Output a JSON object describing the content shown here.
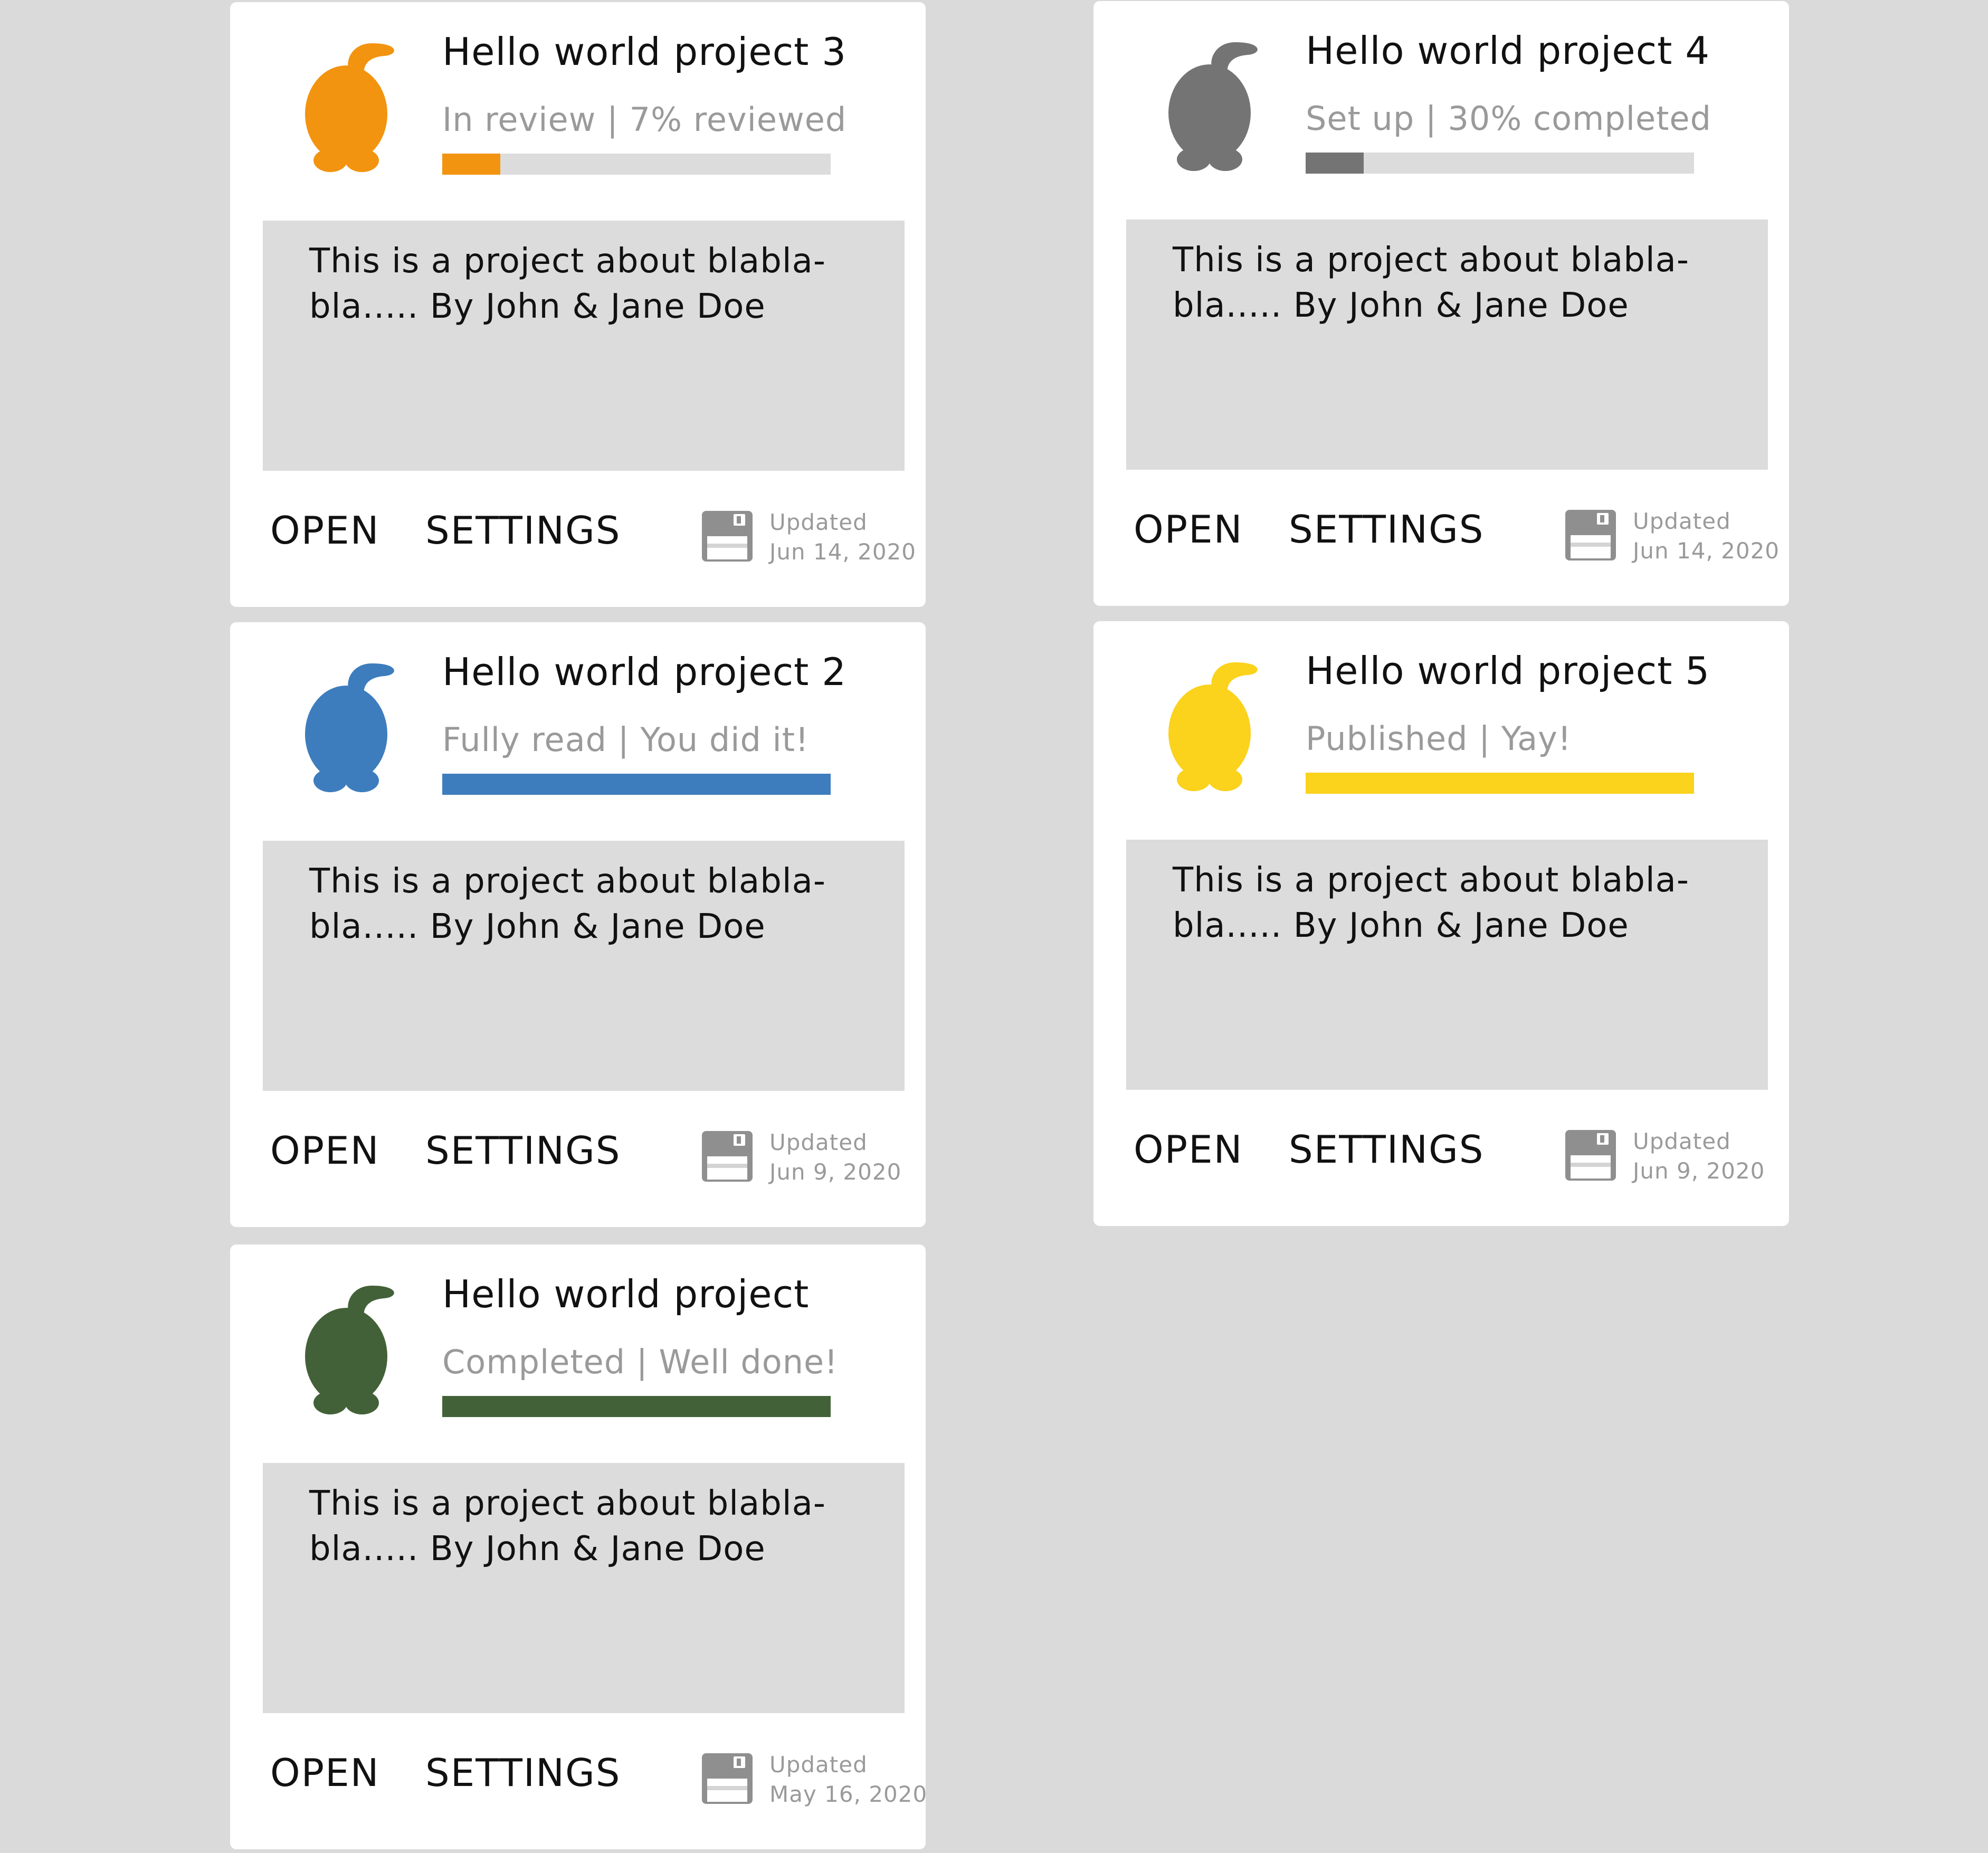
{
  "projects": [
    {
      "title": "Hello world project 3",
      "status": "In review | 7% reviewed",
      "progress": 0.15,
      "color": "#f29410",
      "description": "This is a project about blabla-bla..... By John & Jane Doe",
      "open_label": "OPEN",
      "settings_label": "SETTINGS",
      "updated_label": "Updated",
      "updated_date": "Jun 14, 2020"
    },
    {
      "title": "Hello world project 4",
      "status": "Set up | 30% completed",
      "progress": 0.15,
      "color": "#747474",
      "description": "This is a project about blabla-bla..... By John & Jane Doe",
      "open_label": "OPEN",
      "settings_label": "SETTINGS",
      "updated_label": "Updated",
      "updated_date": "Jun 14, 2020"
    },
    {
      "title": "Hello world project 2",
      "status": "Fully read | You did it!",
      "progress": 1.0,
      "color": "#3d7dbd",
      "description": "This is a project about blabla-bla..... By John & Jane Doe",
      "open_label": "OPEN",
      "settings_label": "SETTINGS",
      "updated_label": "Updated",
      "updated_date": "Jun 9, 2020"
    },
    {
      "title": "Hello world project 5",
      "status": "Published | Yay!",
      "progress": 1.0,
      "color": "#fbd21c",
      "description": "This is a project about blabla-bla..... By John & Jane Doe",
      "open_label": "OPEN",
      "settings_label": "SETTINGS",
      "updated_label": "Updated",
      "updated_date": "Jun 9, 2020"
    },
    {
      "title": "Hello world project",
      "status": "Completed | Well done!",
      "progress": 1.0,
      "color": "#436138",
      "description": "This is a project about blabla-bla..... By John & Jane Doe",
      "open_label": "OPEN",
      "settings_label": "SETTINGS",
      "updated_label": "Updated",
      "updated_date": "May 16, 2020"
    }
  ],
  "icons": {
    "mascot": "mascot-icon",
    "save": "floppy-disk-icon"
  }
}
